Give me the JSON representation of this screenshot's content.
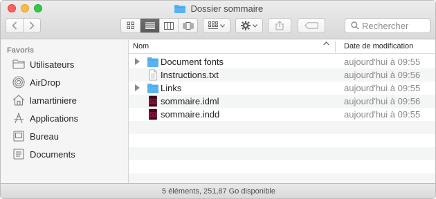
{
  "window": {
    "title": "Dossier sommaire"
  },
  "toolbar": {
    "back_icon": "chevron-left-icon",
    "forward_icon": "chevron-right-icon",
    "view_modes": [
      "icon-view",
      "list-view",
      "column-view",
      "cover-flow-view"
    ],
    "active_view": "list-view",
    "search_placeholder": "Rechercher"
  },
  "sidebar": {
    "header": "Favoris",
    "items": [
      {
        "label": "Utilisateurs",
        "icon": "folder-icon"
      },
      {
        "label": "AirDrop",
        "icon": "airdrop-icon"
      },
      {
        "label": "lamartiniere",
        "icon": "home-icon"
      },
      {
        "label": "Applications",
        "icon": "applications-icon"
      },
      {
        "label": "Bureau",
        "icon": "desktop-icon"
      },
      {
        "label": "Documents",
        "icon": "documents-icon"
      }
    ]
  },
  "columns": {
    "name": "Nom",
    "date": "Date de modification"
  },
  "files": [
    {
      "name": "Document fonts",
      "date": "aujourd'hui à 09:55",
      "kind": "folder",
      "expandable": true
    },
    {
      "name": "Instructions.txt",
      "date": "aujourd'hui à 09:56",
      "kind": "text",
      "expandable": false
    },
    {
      "name": "Links",
      "date": "aujourd'hui à 09:55",
      "kind": "folder",
      "expandable": true
    },
    {
      "name": "sommaire.idml",
      "date": "aujourd'hui à 09:56",
      "kind": "indesign",
      "expandable": false
    },
    {
      "name": "sommaire.indd",
      "date": "aujourd'hui à 09:55",
      "kind": "indesign",
      "expandable": false
    }
  ],
  "status": {
    "text": "5 éléments, 251,87 Go disponible"
  },
  "colors": {
    "folder": "#5ab3f0",
    "indesign": "#49021f",
    "indesign_accent": "#ff3366",
    "close": "#fc605c",
    "minimize": "#fdbc40",
    "zoom": "#34c84a"
  }
}
